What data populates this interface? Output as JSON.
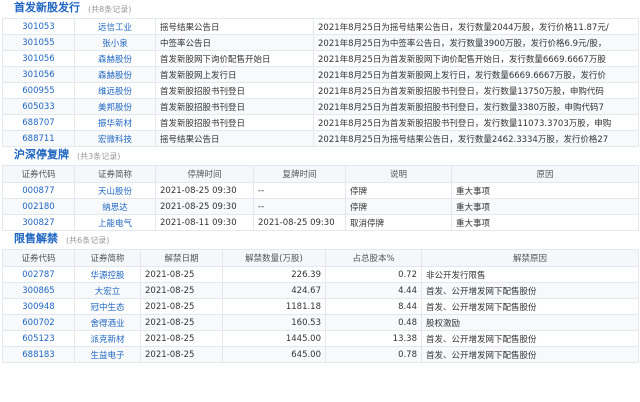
{
  "ipo": {
    "title": "首发新股发行",
    "count": "(共8条记录)",
    "rows": [
      {
        "code": "301053",
        "name": "远信工业",
        "event": "摇号结果公告日",
        "desc": "2021年8月25日为摇号结果公告日，发行数量2044万股，发行价格11.87元/"
      },
      {
        "code": "301055",
        "name": "张小泉",
        "event": "中签率公告日",
        "desc": "2021年8月25日为中签率公告日，发行数量3900万股，发行价格6.9元/股，"
      },
      {
        "code": "301056",
        "name": "森赫股份",
        "event": "首发新股网下询价配售开始日",
        "desc": "2021年8月25日为首发新股网下询价配售开始日，发行数量6669.6667万股"
      },
      {
        "code": "301056",
        "name": "森赫股份",
        "event": "首发新股网上发行日",
        "desc": "2021年8月25日为首发新股网上发行日，发行数量6669.6667万股，发行价"
      },
      {
        "code": "600955",
        "name": "维远股份",
        "event": "首发新股招股书刊登日",
        "desc": "2021年8月25日为首发新股招股书刊登日，发行数量13750万股，申购代码"
      },
      {
        "code": "605033",
        "name": "美邦股份",
        "event": "首发新股招股书刊登日",
        "desc": "2021年8月25日为首发新股招股书刊登日，发行数量3380万股，申购代码7"
      },
      {
        "code": "688707",
        "name": "振华新材",
        "event": "首发新股招股书刊登日",
        "desc": "2021年8月25日为首发新股招股书刊登日，发行数量11073.3703万股，申购"
      },
      {
        "code": "688711",
        "name": "宏微科技",
        "event": "摇号结果公告日",
        "desc": "2021年8月25日为摇号结果公告日，发行数量2462.3334万股，发行价格27"
      }
    ]
  },
  "suspend": {
    "title": "沪深停复牌",
    "count": "(共3条记录)",
    "headers": {
      "code": "证券代码",
      "name": "证券简称",
      "stop": "停牌时间",
      "resume": "复牌时间",
      "note": "说明",
      "reason": "原因"
    },
    "rows": [
      {
        "code": "000877",
        "name": "天山股份",
        "stop": "2021-08-25 09:30",
        "resume": "--",
        "note": "停牌",
        "reason": "重大事项"
      },
      {
        "code": "002180",
        "name": "纳思达",
        "stop": "2021-08-25 09:30",
        "resume": "--",
        "note": "停牌",
        "reason": "重大事项"
      },
      {
        "code": "300827",
        "name": "上能电气",
        "stop": "2021-08-11 09:30",
        "resume": "2021-08-25 09:30",
        "note": "取消停牌",
        "reason": "重大事项"
      }
    ]
  },
  "unlock": {
    "title": "限售解禁",
    "count": "(共6条记录)",
    "headers": {
      "code": "证券代码",
      "name": "证券简称",
      "date": "解禁日期",
      "qty": "解禁数量(万股)",
      "pct": "占总股本%",
      "reason": "解禁原因"
    },
    "rows": [
      {
        "code": "002787",
        "name": "华源控股",
        "date": "2021-08-25",
        "qty": "226.39",
        "pct": "0.72",
        "reason": "非公开发行限售"
      },
      {
        "code": "300865",
        "name": "大宏立",
        "date": "2021-08-25",
        "qty": "424.67",
        "pct": "4.44",
        "reason": "首发、公开增发网下配售股份"
      },
      {
        "code": "300948",
        "name": "冠中生态",
        "date": "2021-08-25",
        "qty": "1181.18",
        "pct": "8.44",
        "reason": "首发、公开增发网下配售股份"
      },
      {
        "code": "600702",
        "name": "舍得酒业",
        "date": "2021-08-25",
        "qty": "160.53",
        "pct": "0.48",
        "reason": "股权激励"
      },
      {
        "code": "605123",
        "name": "派克新材",
        "date": "2021-08-25",
        "qty": "1445.00",
        "pct": "13.38",
        "reason": "首发、公开增发网下配售股份"
      },
      {
        "code": "688183",
        "name": "生益电子",
        "date": "2021-08-25",
        "qty": "645.00",
        "pct": "0.78",
        "reason": "首发、公开增发网下配售股份"
      }
    ]
  }
}
